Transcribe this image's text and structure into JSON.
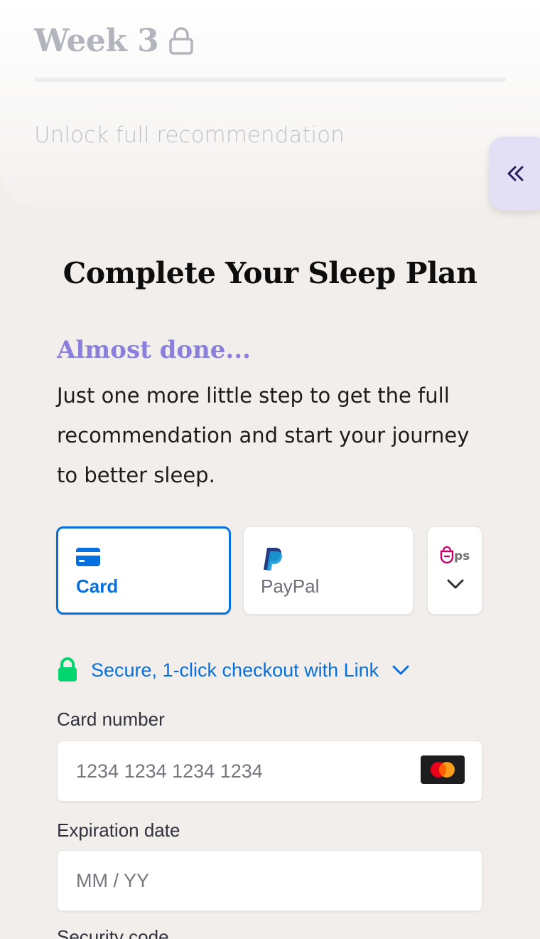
{
  "week": {
    "title": "Week 3",
    "locked_icon": "lock-icon",
    "unlock_text": "Unlock full recommendation"
  },
  "collapse_button": {
    "icon": "double-chevron-left-icon"
  },
  "checkout": {
    "title": "Complete Your Sleep Plan",
    "subtitle": "Almost done...",
    "intro": "Just one more little step to get the full recommendation and start your journey to better sleep."
  },
  "payment_methods": {
    "tabs": [
      {
        "label": "Card",
        "icon": "credit-card-icon",
        "selected": true
      },
      {
        "label": "PayPal",
        "icon": "paypal-icon",
        "selected": false
      },
      {
        "label": "eps",
        "icon": "eps-icon",
        "selected": false
      }
    ]
  },
  "link_checkout": {
    "text": "Secure, 1-click checkout with Link",
    "icon": "lock-icon"
  },
  "form": {
    "card_number_label": "Card number",
    "card_number_placeholder": "1234 1234 1234 1234",
    "expiration_label": "Expiration date",
    "expiration_placeholder": "MM / YY",
    "security_label": "Security code"
  },
  "colors": {
    "accent_blue": "#0570de",
    "brand_purple": "#8b7fdc",
    "link_green": "#00d66f"
  }
}
